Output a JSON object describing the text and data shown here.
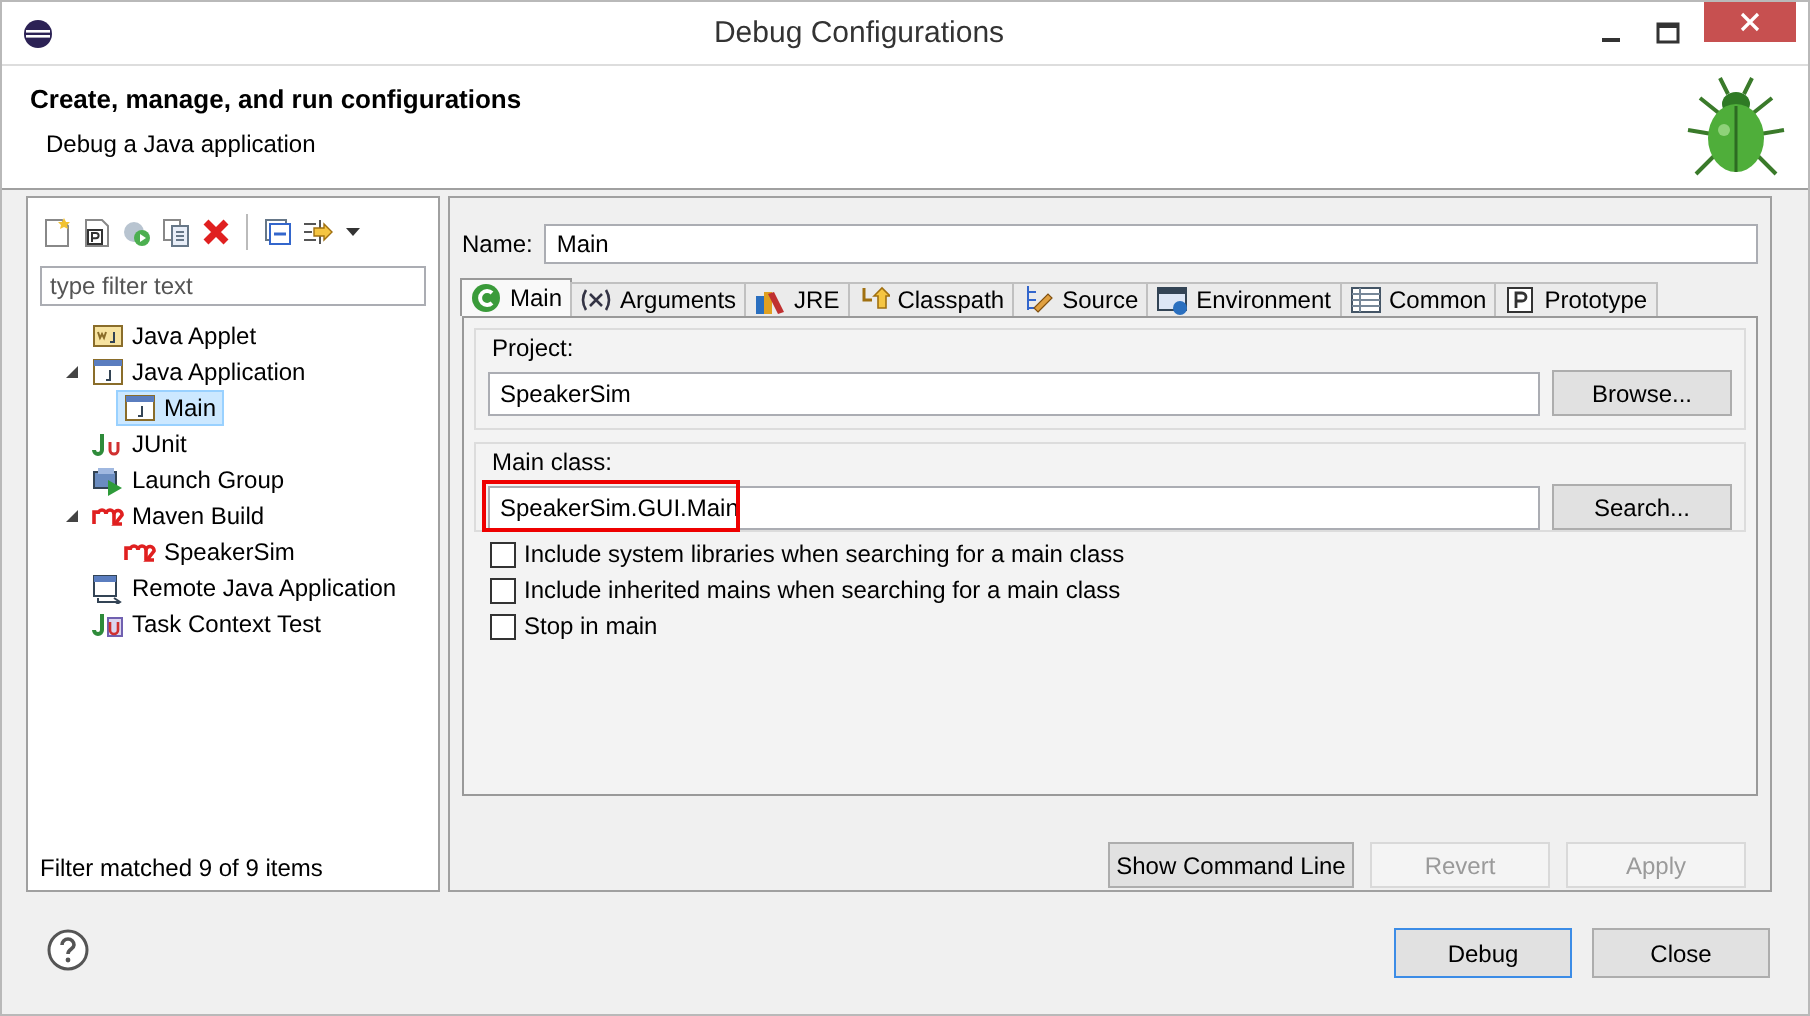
{
  "window": {
    "title": "Debug Configurations"
  },
  "header": {
    "title": "Create, manage, and run configurations",
    "subtitle": "Debug a Java application"
  },
  "filter": {
    "placeholder": "type filter text"
  },
  "tree": [
    {
      "label": "Java Applet",
      "kind": "applet",
      "selected": false
    },
    {
      "label": "Java Application",
      "kind": "app",
      "selected": false,
      "expanded": true,
      "children": [
        {
          "label": "Main",
          "kind": "app",
          "selected": true
        }
      ]
    },
    {
      "label": "JUnit",
      "kind": "junit",
      "selected": false
    },
    {
      "label": "Launch Group",
      "kind": "group",
      "selected": false
    },
    {
      "label": "Maven Build",
      "kind": "maven",
      "selected": false,
      "expanded": true,
      "children": [
        {
          "label": "SpeakerSim",
          "kind": "maven",
          "selected": false
        }
      ]
    },
    {
      "label": "Remote Java Application",
      "kind": "remote",
      "selected": false
    },
    {
      "label": "Task Context Test",
      "kind": "task",
      "selected": false
    }
  ],
  "filter_status": "Filter matched 9 of 9 items",
  "name_field": {
    "label": "Name:",
    "value": "Main"
  },
  "tabs": [
    {
      "label": "Main",
      "kind": "main",
      "selected": true
    },
    {
      "label": "Arguments",
      "kind": "args",
      "selected": false
    },
    {
      "label": "JRE",
      "kind": "jre",
      "selected": false
    },
    {
      "label": "Classpath",
      "kind": "classpath",
      "selected": false
    },
    {
      "label": "Source",
      "kind": "source",
      "selected": false
    },
    {
      "label": "Environment",
      "kind": "env",
      "selected": false
    },
    {
      "label": "Common",
      "kind": "common",
      "selected": false
    },
    {
      "label": "Prototype",
      "kind": "proto",
      "selected": false
    }
  ],
  "project": {
    "label": "Project:",
    "value": "SpeakerSim",
    "button": "Browse..."
  },
  "main_class": {
    "label": "Main class:",
    "value": "SpeakerSim.GUI.Main",
    "highlighted": true,
    "button": "Search..."
  },
  "options": [
    {
      "label": "Include system libraries when searching for a main class",
      "checked": false
    },
    {
      "label": "Include inherited mains when searching for a main class",
      "checked": false
    },
    {
      "label": "Stop in main",
      "checked": false
    }
  ],
  "actions": [
    {
      "label": "Show Command Line",
      "disabled": false
    },
    {
      "label": "Revert",
      "disabled": true
    },
    {
      "label": "Apply",
      "disabled": true
    }
  ],
  "dialog_buttons": [
    {
      "label": "Debug",
      "default": true
    },
    {
      "label": "Close",
      "default": false
    }
  ]
}
